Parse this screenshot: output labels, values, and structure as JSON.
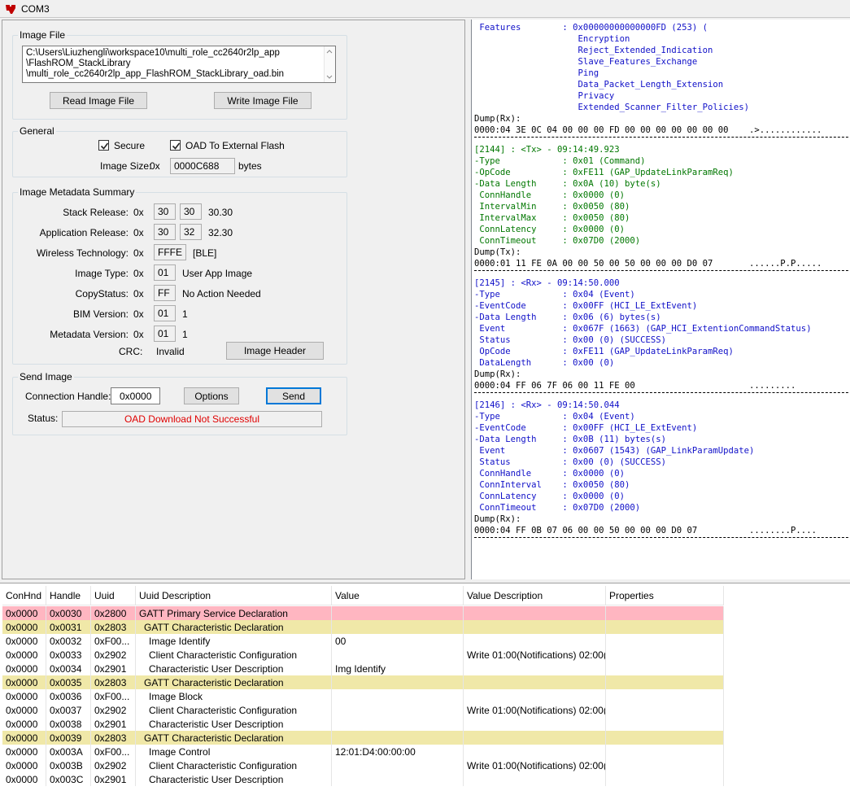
{
  "window": {
    "title": "COM3"
  },
  "image_file": {
    "group_title": "Image File",
    "path_lines": [
      "C:\\Users\\Liuzhengli\\workspace10\\multi_role_cc2640r2lp_app",
      "\\FlashROM_StackLibrary",
      "\\multi_role_cc2640r2lp_app_FlashROM_StackLibrary_oad.bin"
    ],
    "read_button": "Read Image File",
    "write_button": "Write Image File"
  },
  "general": {
    "group_title": "General",
    "secure_label": "Secure",
    "secure_checked": true,
    "external_label": "OAD To External Flash",
    "external_checked": true,
    "size_label": "Image Size:",
    "size_prefix": "0x",
    "size_value": "0000C688",
    "size_unit": "bytes"
  },
  "metadata": {
    "group_title": "Image Metadata Summary",
    "stack_release": {
      "label": "Stack Release:",
      "prefix": "0x",
      "v1": "30",
      "v2": "30",
      "text": "30.30"
    },
    "app_release": {
      "label": "Application Release:",
      "prefix": "0x",
      "v1": "30",
      "v2": "32",
      "text": "32.30"
    },
    "wireless": {
      "label": "Wireless Technology:",
      "prefix": "0x",
      "value": "FFFE",
      "text": "[BLE]"
    },
    "image_type": {
      "label": "Image Type:",
      "prefix": "0x",
      "value": "01",
      "text": "User App Image"
    },
    "copy_status": {
      "label": "CopyStatus:",
      "prefix": "0x",
      "value": "FF",
      "text": "No Action Needed"
    },
    "bim_version": {
      "label": "BIM Version:",
      "prefix": "0x",
      "value": "01",
      "text": "1"
    },
    "meta_version": {
      "label": "Metadata Version:",
      "prefix": "0x",
      "value": "01",
      "text": "1"
    },
    "crc": {
      "label": "CRC:",
      "value": "Invalid"
    },
    "header_button": "Image Header"
  },
  "send_image": {
    "group_title": "Send Image",
    "conn_label": "Connection Handle:",
    "conn_value": "0x0000",
    "options_button": "Options",
    "send_button": "Send",
    "status_label": "Status:",
    "status_value": "OAD Download Not Successful"
  },
  "log": [
    {
      "t": "line",
      "c": "blue",
      "text": " Features        : 0x00000000000000FD (253) ("
    },
    {
      "t": "line",
      "c": "blue",
      "text": "                    Encryption"
    },
    {
      "t": "line",
      "c": "blue",
      "text": "                    Reject_Extended_Indication"
    },
    {
      "t": "line",
      "c": "blue",
      "text": "                    Slave_Features_Exchange"
    },
    {
      "t": "line",
      "c": "blue",
      "text": "                    Ping"
    },
    {
      "t": "line",
      "c": "blue",
      "text": "                    Data_Packet_Length_Extension"
    },
    {
      "t": "line",
      "c": "blue",
      "text": "                    Privacy"
    },
    {
      "t": "line",
      "c": "blue",
      "text": "                    Extended_Scanner_Filter_Policies)"
    },
    {
      "t": "line",
      "c": "black",
      "text": "Dump(Rx):"
    },
    {
      "t": "line",
      "c": "black",
      "text": "0000:04 3E 0C 04 00 00 00 FD 00 00 00 00 00 00 00    .>............"
    },
    {
      "t": "sep"
    },
    {
      "t": "line",
      "c": "green",
      "text": "[2144] : <Tx> - 09:14:49.923"
    },
    {
      "t": "line",
      "c": "green",
      "text": "-Type            : 0x01 (Command)"
    },
    {
      "t": "line",
      "c": "green",
      "text": "-OpCode          : 0xFE11 (GAP_UpdateLinkParamReq)"
    },
    {
      "t": "line",
      "c": "green",
      "text": "-Data Length     : 0x0A (10) byte(s)"
    },
    {
      "t": "line",
      "c": "green",
      "text": " ConnHandle      : 0x0000 (0)"
    },
    {
      "t": "line",
      "c": "green",
      "text": " IntervalMin     : 0x0050 (80)"
    },
    {
      "t": "line",
      "c": "green",
      "text": " IntervalMax     : 0x0050 (80)"
    },
    {
      "t": "line",
      "c": "green",
      "text": " ConnLatency     : 0x0000 (0)"
    },
    {
      "t": "line",
      "c": "green",
      "text": " ConnTimeout     : 0x07D0 (2000)"
    },
    {
      "t": "line",
      "c": "black",
      "text": "Dump(Tx):"
    },
    {
      "t": "line",
      "c": "black",
      "text": "0000:01 11 FE 0A 00 00 50 00 50 00 00 00 D0 07       ......P.P....."
    },
    {
      "t": "sep"
    },
    {
      "t": "line",
      "c": "blue",
      "text": "[2145] : <Rx> - 09:14:50.000"
    },
    {
      "t": "line",
      "c": "blue",
      "text": "-Type            : 0x04 (Event)"
    },
    {
      "t": "line",
      "c": "blue",
      "text": "-EventCode       : 0x00FF (HCI_LE_ExtEvent)"
    },
    {
      "t": "line",
      "c": "blue",
      "text": "-Data Length     : 0x06 (6) bytes(s)"
    },
    {
      "t": "line",
      "c": "blue",
      "text": " Event           : 0x067F (1663) (GAP_HCI_ExtentionCommandStatus)"
    },
    {
      "t": "line",
      "c": "blue",
      "text": " Status          : 0x00 (0) (SUCCESS)"
    },
    {
      "t": "line",
      "c": "blue",
      "text": " OpCode          : 0xFE11 (GAP_UpdateLinkParamReq)"
    },
    {
      "t": "line",
      "c": "blue",
      "text": " DataLength      : 0x00 (0)"
    },
    {
      "t": "line",
      "c": "black",
      "text": "Dump(Rx):"
    },
    {
      "t": "line",
      "c": "black",
      "text": "0000:04 FF 06 7F 06 00 11 FE 00                      ........."
    },
    {
      "t": "sep"
    },
    {
      "t": "line",
      "c": "blue",
      "text": "[2146] : <Rx> - 09:14:50.044"
    },
    {
      "t": "line",
      "c": "blue",
      "text": "-Type            : 0x04 (Event)"
    },
    {
      "t": "line",
      "c": "blue",
      "text": "-EventCode       : 0x00FF (HCI_LE_ExtEvent)"
    },
    {
      "t": "line",
      "c": "blue",
      "text": "-Data Length     : 0x0B (11) bytes(s)"
    },
    {
      "t": "line",
      "c": "blue",
      "text": " Event           : 0x0607 (1543) (GAP_LinkParamUpdate)"
    },
    {
      "t": "line",
      "c": "blue",
      "text": " Status          : 0x00 (0) (SUCCESS)"
    },
    {
      "t": "line",
      "c": "blue",
      "text": " ConnHandle      : 0x0000 (0)"
    },
    {
      "t": "line",
      "c": "blue",
      "text": " ConnInterval    : 0x0050 (80)"
    },
    {
      "t": "line",
      "c": "blue",
      "text": " ConnLatency     : 0x0000 (0)"
    },
    {
      "t": "line",
      "c": "blue",
      "text": " ConnTimeout     : 0x07D0 (2000)"
    },
    {
      "t": "line",
      "c": "black",
      "text": "Dump(Rx):"
    },
    {
      "t": "line",
      "c": "black",
      "text": "0000:04 FF 0B 07 06 00 00 50 00 00 00 D0 07          ........P...."
    },
    {
      "t": "sep"
    }
  ],
  "table": {
    "columns": [
      "ConHnd",
      "Handle",
      "Uuid",
      "Uuid Description",
      "Value",
      "Value Description",
      "Properties"
    ],
    "rows": [
      {
        "hl": "pink",
        "indent": 0,
        "cells": [
          "0x0000",
          "0x0030",
          "0x2800",
          "GATT Primary Service Declaration",
          "",
          "",
          ""
        ]
      },
      {
        "hl": "yellow",
        "indent": 1,
        "cells": [
          "0x0000",
          "0x0031",
          "0x2803",
          "GATT Characteristic Declaration",
          "",
          "",
          ""
        ]
      },
      {
        "hl": "",
        "indent": 2,
        "cells": [
          "0x0000",
          "0x0032",
          "0xF00...",
          "Image Identify",
          "00",
          "",
          ""
        ]
      },
      {
        "hl": "",
        "indent": 2,
        "cells": [
          "0x0000",
          "0x0033",
          "0x2902",
          "Client Characteristic Configuration",
          "",
          "Write 01:00(Notifications) 02:00(...",
          ""
        ]
      },
      {
        "hl": "",
        "indent": 2,
        "cells": [
          "0x0000",
          "0x0034",
          "0x2901",
          "Characteristic User Description",
          "Img Identify",
          "",
          ""
        ]
      },
      {
        "hl": "yellow",
        "indent": 1,
        "cells": [
          "0x0000",
          "0x0035",
          "0x2803",
          "GATT Characteristic Declaration",
          "",
          "",
          ""
        ]
      },
      {
        "hl": "",
        "indent": 2,
        "cells": [
          "0x0000",
          "0x0036",
          "0xF00...",
          "Image Block",
          "",
          "",
          ""
        ]
      },
      {
        "hl": "",
        "indent": 2,
        "cells": [
          "0x0000",
          "0x0037",
          "0x2902",
          "Client Characteristic Configuration",
          "",
          "Write 01:00(Notifications) 02:00(...",
          ""
        ]
      },
      {
        "hl": "",
        "indent": 2,
        "cells": [
          "0x0000",
          "0x0038",
          "0x2901",
          "Characteristic User Description",
          "",
          "",
          ""
        ]
      },
      {
        "hl": "yellow",
        "indent": 1,
        "cells": [
          "0x0000",
          "0x0039",
          "0x2803",
          "GATT Characteristic Declaration",
          "",
          "",
          ""
        ]
      },
      {
        "hl": "",
        "indent": 2,
        "cells": [
          "0x0000",
          "0x003A",
          "0xF00...",
          "Image Control",
          "12:01:D4:00:00:00",
          "",
          ""
        ]
      },
      {
        "hl": "",
        "indent": 2,
        "cells": [
          "0x0000",
          "0x003B",
          "0x2902",
          "Client Characteristic Configuration",
          "",
          "Write 01:00(Notifications) 02:00(...",
          ""
        ]
      },
      {
        "hl": "",
        "indent": 2,
        "cells": [
          "0x0000",
          "0x003C",
          "0x2901",
          "Characteristic User Description",
          "",
          "",
          ""
        ]
      }
    ]
  }
}
